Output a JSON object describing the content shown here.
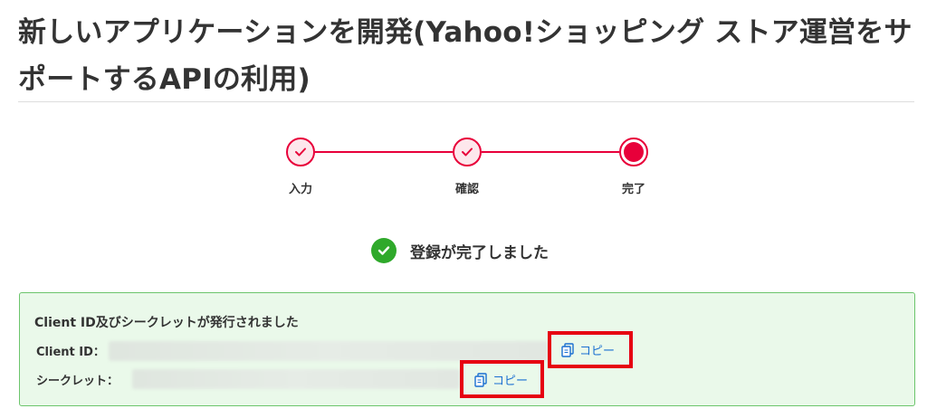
{
  "page": {
    "title": "新しいアプリケーションを開発(Yahoo!ショッピング ストア運営をサポートするAPIの利用)"
  },
  "stepper": {
    "steps": [
      {
        "label": "入力",
        "state": "done"
      },
      {
        "label": "確認",
        "state": "done"
      },
      {
        "label": "完了",
        "state": "current"
      }
    ],
    "active_color": "#e8003a"
  },
  "success": {
    "message": "登録が完了しました",
    "icon": "check-circle-icon",
    "color": "#2fa92b"
  },
  "notice": {
    "heading": "Client ID及びシークレットが発行されました",
    "client_id": {
      "label": "Client ID：",
      "copy_label": "コピー"
    },
    "secret": {
      "label": "シークレット：",
      "copy_label": "コピー"
    },
    "highlight_color": "#e60012",
    "link_color": "#1a6fd1"
  }
}
